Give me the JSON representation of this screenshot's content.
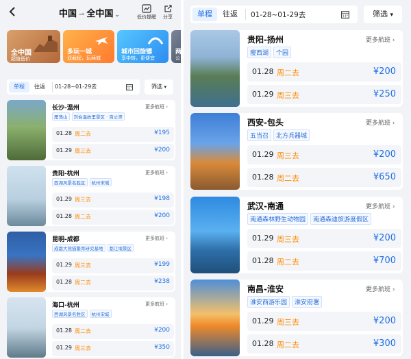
{
  "header": {
    "from": "中国",
    "arrow": "⇀",
    "to": "全中国",
    "alert_label": "低价提醒",
    "share_label": "分享"
  },
  "banners": [
    {
      "title": "全中国",
      "subtitle": "超值低价"
    },
    {
      "title": "多玩一城",
      "subtitle": "双截程，玩两城"
    },
    {
      "title": "城市回旋镖",
      "subtitle": "享中转，更便宜"
    },
    {
      "title": "两",
      "subtitle": "公"
    }
  ],
  "tabs": {
    "oneway": "单程",
    "roundtrip": "往返",
    "dates": "01-28~01-29去",
    "filter": "筛选"
  },
  "more_label": "更多航班",
  "left_routes": [
    {
      "name": "长沙-温州",
      "tags": [
        "雁荡山",
        "刘伯温故里景区 · 百丈漈"
      ],
      "rows": [
        {
          "date": "01.28",
          "weekday": "周二去",
          "price": "¥195"
        },
        {
          "date": "01.29",
          "weekday": "周三去",
          "price": "¥200"
        }
      ]
    },
    {
      "name": "贵阳-杭州",
      "tags": [
        "西湖风景名胜区",
        "杭州宋城"
      ],
      "rows": [
        {
          "date": "01.29",
          "weekday": "周三去",
          "price": "¥198"
        },
        {
          "date": "01.28",
          "weekday": "周二去",
          "price": "¥200"
        }
      ]
    },
    {
      "name": "昆明-成都",
      "tags": [
        "成都大熊猫繁育研究基地",
        "都江堰景区"
      ],
      "rows": [
        {
          "date": "01.29",
          "weekday": "周三去",
          "price": "¥199"
        },
        {
          "date": "01.28",
          "weekday": "周二去",
          "price": "¥238"
        }
      ]
    },
    {
      "name": "海口-杭州",
      "tags": [
        "西湖风景名胜区",
        "杭州宋城"
      ],
      "rows": [
        {
          "date": "01.28",
          "weekday": "周二去",
          "price": "¥200"
        },
        {
          "date": "01.29",
          "weekday": "周三去",
          "price": "¥350"
        }
      ]
    }
  ],
  "right_routes": [
    {
      "name": "贵阳-扬州",
      "tags": [
        "瘦西湖",
        "个园"
      ],
      "rows": [
        {
          "date": "01.28",
          "weekday": "周二去",
          "price": "¥200"
        },
        {
          "date": "01.29",
          "weekday": "周三去",
          "price": "¥250"
        }
      ]
    },
    {
      "name": "西安-包头",
      "tags": [
        "五当召",
        "北方兵器城"
      ],
      "rows": [
        {
          "date": "01.29",
          "weekday": "周三去",
          "price": "¥200"
        },
        {
          "date": "01.28",
          "weekday": "周二去",
          "price": "¥650"
        }
      ]
    },
    {
      "name": "武汉-南通",
      "tags": [
        "南通森林野生动物园",
        "南通森迪旅游度假区"
      ],
      "rows": [
        {
          "date": "01.29",
          "weekday": "周三去",
          "price": "¥200"
        },
        {
          "date": "01.28",
          "weekday": "周二去",
          "price": "¥700"
        }
      ]
    },
    {
      "name": "南昌-淮安",
      "tags": [
        "淮安西游乐园",
        "淮安府署"
      ],
      "rows": [
        {
          "date": "01.29",
          "weekday": "周三去",
          "price": "¥200"
        },
        {
          "date": "01.28",
          "weekday": "周二去",
          "price": "¥300"
        }
      ]
    }
  ],
  "colors": {
    "accent": "#1f6fe5",
    "weekday": "#ff8a00",
    "tag_text": "#2a6fd6"
  }
}
